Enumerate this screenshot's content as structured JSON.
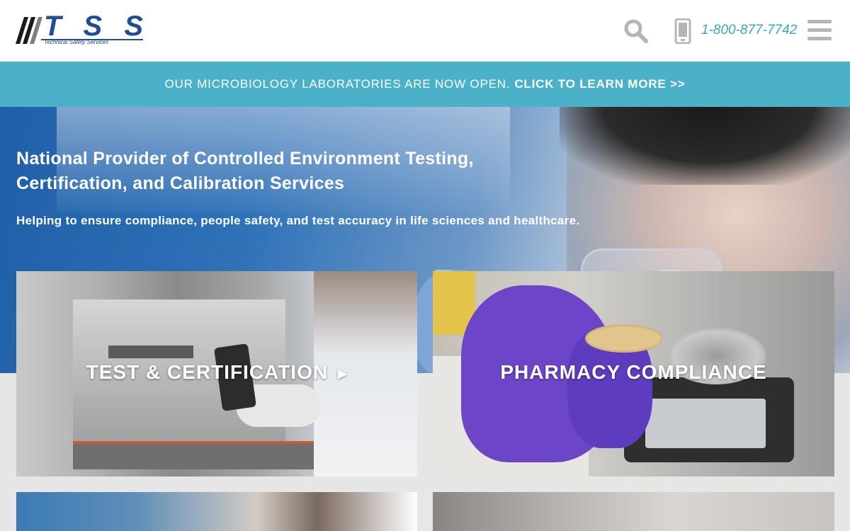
{
  "header": {
    "logo_text": "TSS",
    "logo_tagline": "Technical Safety Services",
    "phone": "1-800-877-7742",
    "icons": [
      "search-icon",
      "phone-icon",
      "menu-icon"
    ]
  },
  "announcement": {
    "text": "OUR MICROBIOLOGY LABORATORIES ARE NOW OPEN.",
    "link": "CLICK TO LEARN MORE >>"
  },
  "hero": {
    "title_line1": "National Provider of Controlled Environment Testing,",
    "title_line2": "Certification, and Calibration Services",
    "subtitle": "Helping to ensure compliance, people safety, and test accuracy in life sciences and healthcare."
  },
  "cards": [
    {
      "title": "TEST & CERTIFICATION",
      "arrow": "▶"
    },
    {
      "title": "PHARMACY COMPLIANCE"
    },
    {
      "title": ""
    },
    {
      "title": ""
    }
  ],
  "colors": {
    "accent": "#4bb1c8",
    "phone": "#3aa7be",
    "logo_blue": "#1f4e96",
    "icon_gray": "#b5b5b5"
  }
}
